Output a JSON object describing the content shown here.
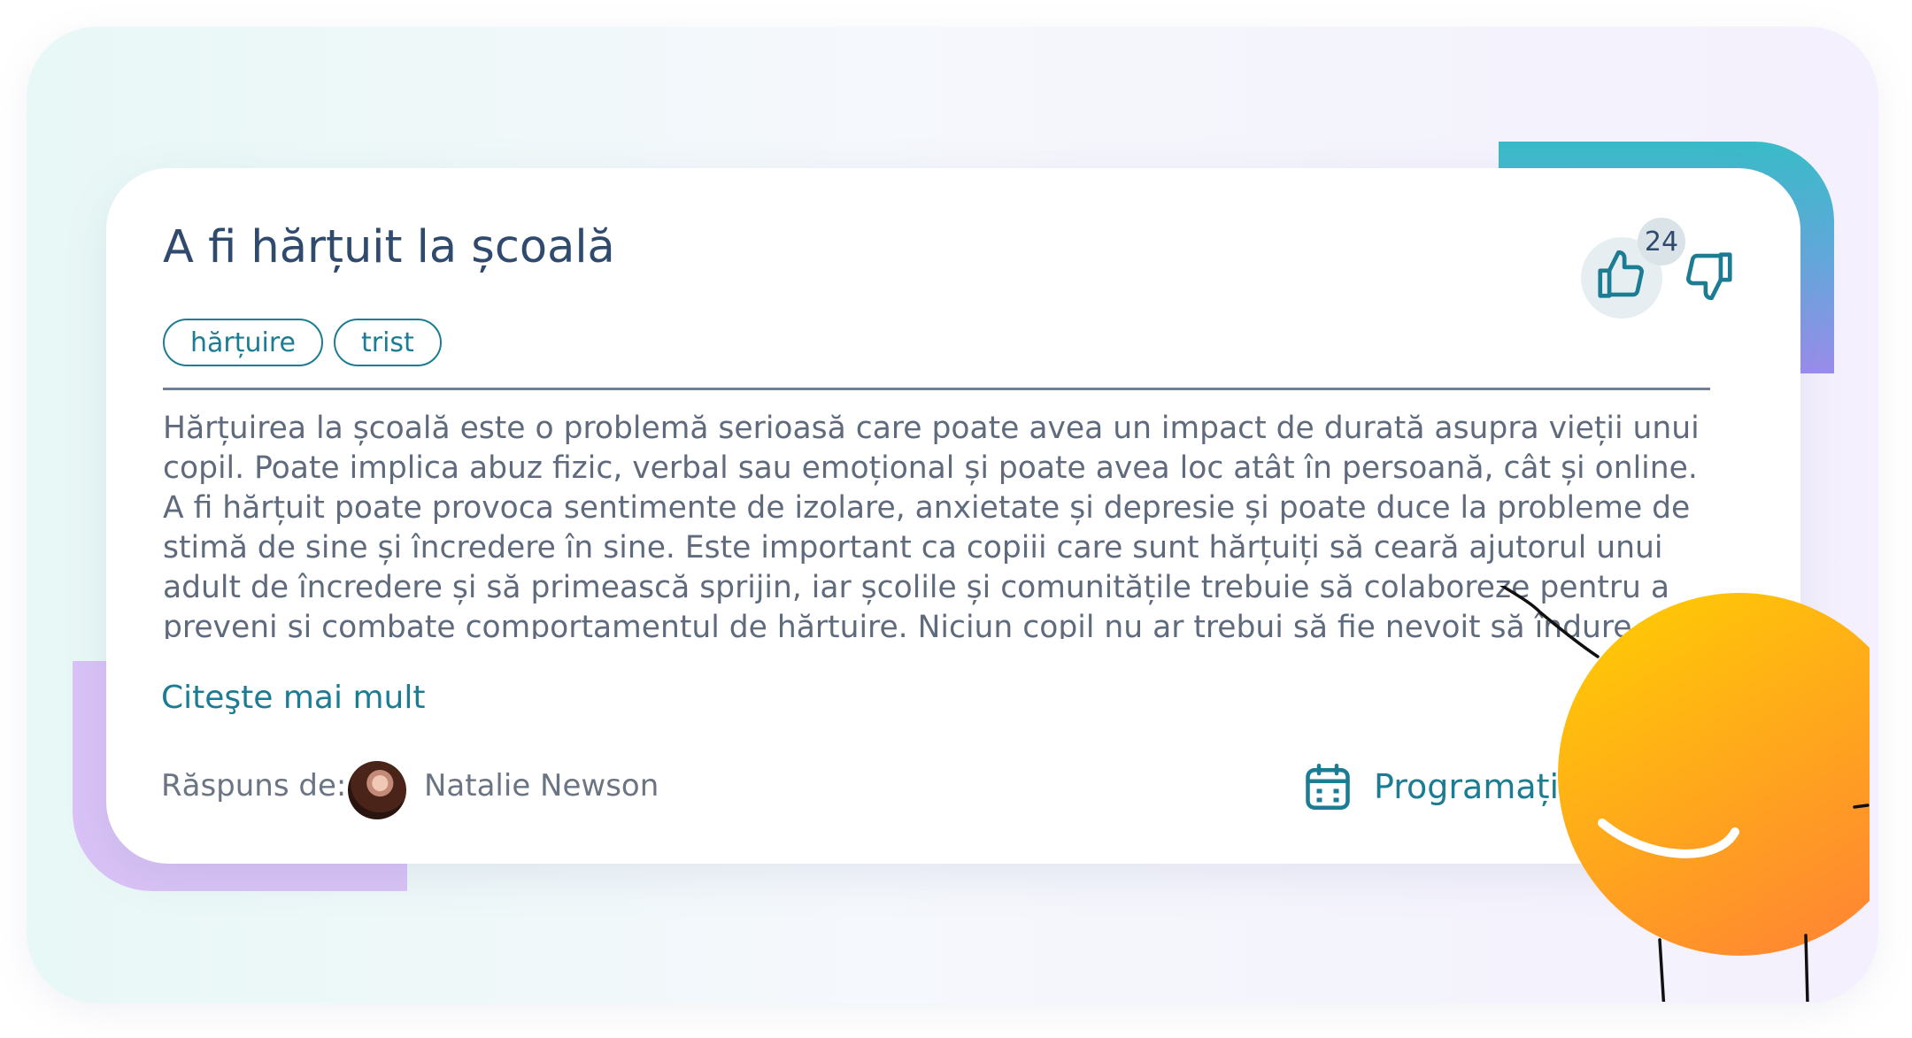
{
  "card": {
    "title": "A fi hărțuit la școală",
    "tags": [
      "hărțuire",
      "trist"
    ],
    "body": "Hărțuirea la școală este o problemă serioasă care poate avea un impact de durată asupra vieții unui copil. Poate implica abuz fizic, verbal sau emoțional și poate avea loc atât în persoană, cât și online. A fi hărțuit poate provoca sentimente de izolare, anxietate și depresie și poate duce la probleme de stimă de sine și încredere în sine. Este important ca copiii care sunt hărțuiți să ceară ajutorul unui adult de încredere și să primească sprijin, iar școlile și comunitățile trebuie să colaboreze pentru a preveni și combate comportamentul de hărțuire. Niciun copil nu ar trebui să fie nevoit să îndure d",
    "read_more": "Citeşte mai mult",
    "answered_by_label": "Răspuns de:",
    "author_name": "Natalie Newson",
    "schedule_label": "Programați c",
    "likes": "24"
  },
  "icons": {
    "like": "thumbs-up-icon",
    "dislike": "thumbs-down-icon",
    "calendar": "calendar-icon"
  },
  "colors": {
    "accent": "#1b7c93",
    "title": "#2f4a6d",
    "body_text": "#5f6b7d",
    "mascot_top": "#ffd000",
    "mascot_bottom": "#ff8a30"
  }
}
